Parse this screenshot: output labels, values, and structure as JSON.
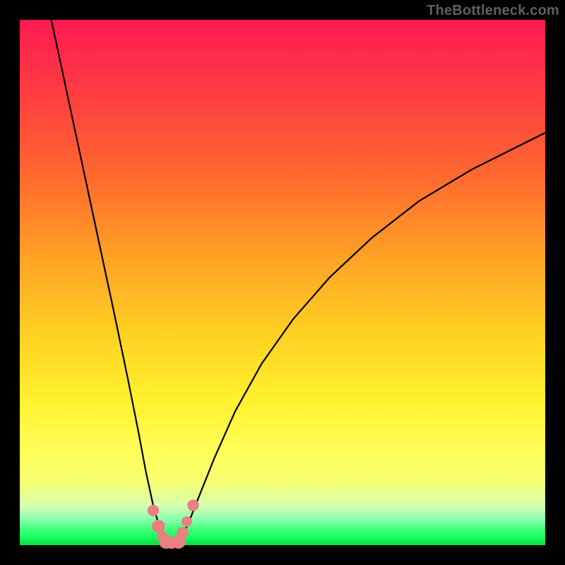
{
  "watermark": {
    "text": "TheBottleneck.com"
  },
  "chart_data": {
    "type": "line",
    "title": "",
    "xlabel": "",
    "ylabel": "",
    "xlim": [
      0,
      100
    ],
    "ylim": [
      0,
      100
    ],
    "grid": false,
    "background": "red-yellow-green vertical gradient (high=red, low=green)",
    "series": [
      {
        "name": "left-branch",
        "note": "steep descending curve from upper-left to valley",
        "x": [
          6,
          9,
          12,
          15,
          18,
          20.5,
          22.5,
          24,
          25.3,
          26.4,
          27.2,
          27.8
        ],
        "y": [
          100,
          86,
          72,
          58,
          44,
          32,
          22,
          14,
          8,
          4,
          1.5,
          0.4
        ]
      },
      {
        "name": "right-branch",
        "note": "concave ascending curve from valley toward upper-right",
        "x": [
          30.2,
          31,
          32.2,
          34,
          37,
          41,
          46,
          52,
          59,
          67,
          76,
          86,
          97,
          100
        ],
        "y": [
          0.4,
          1.8,
          4.5,
          9,
          16.5,
          25.5,
          34.5,
          43,
          51,
          58.5,
          65.5,
          71.5,
          77,
          78.5
        ]
      },
      {
        "name": "valley-floor",
        "note": "near-flat segment at the bottom",
        "x": [
          27.8,
          28.5,
          29.3,
          30.2
        ],
        "y": [
          0.4,
          0.15,
          0.15,
          0.4
        ]
      }
    ],
    "markers": [
      {
        "series": "valley",
        "x": 25.4,
        "y": 6.6,
        "r": 1.1
      },
      {
        "series": "valley",
        "x": 26.4,
        "y": 3.6,
        "r": 1.25
      },
      {
        "series": "valley",
        "x": 27.1,
        "y": 1.7,
        "r": 1.0
      },
      {
        "series": "valley",
        "x": 27.8,
        "y": 0.7,
        "r": 1.35
      },
      {
        "series": "valley",
        "x": 28.9,
        "y": 0.3,
        "r": 1.0
      },
      {
        "series": "valley",
        "x": 30.2,
        "y": 0.7,
        "r": 1.35
      },
      {
        "series": "valley",
        "x": 31.0,
        "y": 2.4,
        "r": 1.1
      },
      {
        "series": "valley",
        "x": 31.8,
        "y": 4.5,
        "r": 1.0
      },
      {
        "series": "valley",
        "x": 33.0,
        "y": 7.6,
        "r": 1.1
      }
    ],
    "marker_style": {
      "fill": "#e98080",
      "stroke": "none"
    }
  }
}
